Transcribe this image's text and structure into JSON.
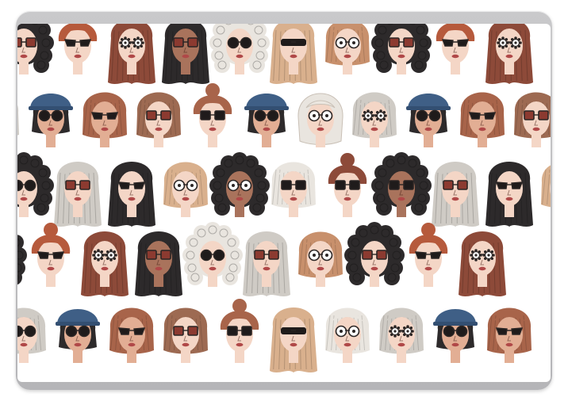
{
  "palette": {
    "frame": "#c2c2c5",
    "background": "#ffffff",
    "skin_light": "#f4d6c6",
    "skin_mid": "#e2ae94",
    "skin_dark": "#a9735c",
    "lips": "#b04848",
    "ink": "#2a2524",
    "hat_blue": "#3f5f86",
    "lens_red": "#8c3a30"
  },
  "hair_colors": {
    "ginger": "#b65a3c",
    "auburn": "#8d4a39",
    "brown": "#9d6a52",
    "black": "#2d2a2b",
    "grey": "#cfcbc5",
    "white": "#e9e5df",
    "blonde": "#d9b08d",
    "sandy": "#c8906c",
    "chestnut": "#a8644a"
  },
  "rows": [
    [
      {
        "hair": "black",
        "style": "curly",
        "skin": "skin_light",
        "glasses": "square_red"
      },
      {
        "hair": "ginger",
        "style": "bun",
        "skin": "skin_light",
        "glasses": "cat"
      },
      {
        "hair": "auburn",
        "style": "long",
        "skin": "skin_light",
        "glasses": "flower"
      },
      {
        "hair": "black",
        "style": "long",
        "skin": "skin_dark",
        "glasses": "square_red"
      },
      {
        "hair": "white",
        "style": "curly",
        "skin": "skin_light",
        "glasses": "round"
      },
      {
        "hair": "blonde",
        "style": "long",
        "skin": "skin_light",
        "glasses": "visor"
      },
      {
        "hair": "sandy",
        "style": "bob",
        "skin": "skin_light",
        "glasses": "round_white"
      },
      {
        "hair": "black",
        "style": "curly",
        "skin": "skin_light",
        "glasses": "square_red"
      },
      {
        "hair": "ginger",
        "style": "bun",
        "skin": "skin_light",
        "glasses": "cat"
      },
      {
        "hair": "auburn",
        "style": "long",
        "skin": "skin_light",
        "glasses": "flower"
      }
    ],
    [
      {
        "hair": "grey",
        "style": "bob",
        "skin": "skin_light",
        "glasses": "round"
      },
      {
        "hair": "black",
        "style": "hat",
        "skin": "skin_mid",
        "glasses": "round"
      },
      {
        "hair": "chestnut",
        "style": "bob",
        "skin": "skin_mid",
        "glasses": "cat"
      },
      {
        "hair": "brown",
        "style": "bob",
        "skin": "skin_light",
        "glasses": "square_red"
      },
      {
        "hair": "chestnut",
        "style": "bun",
        "skin": "skin_light",
        "glasses": "square"
      },
      {
        "hair": "black",
        "style": "hat",
        "skin": "skin_mid",
        "glasses": "round"
      },
      {
        "hair": "white",
        "style": "headscarf",
        "skin": "skin_light",
        "glasses": "round_white"
      },
      {
        "hair": "grey",
        "style": "bob",
        "skin": "skin_light",
        "glasses": "flower"
      },
      {
        "hair": "black",
        "style": "hat",
        "skin": "skin_mid",
        "glasses": "round"
      },
      {
        "hair": "chestnut",
        "style": "bob",
        "skin": "skin_mid",
        "glasses": "cat"
      },
      {
        "hair": "brown",
        "style": "bob",
        "skin": "skin_light",
        "glasses": "square_red"
      }
    ],
    [
      {
        "hair": "black",
        "style": "curly",
        "skin": "skin_light",
        "glasses": "round"
      },
      {
        "hair": "grey",
        "style": "long",
        "skin": "skin_light",
        "glasses": "square_red"
      },
      {
        "hair": "black",
        "style": "long",
        "skin": "skin_light",
        "glasses": "cat"
      },
      {
        "hair": "blonde",
        "style": "bob",
        "skin": "skin_light",
        "glasses": "round_white"
      },
      {
        "hair": "black",
        "style": "curly",
        "skin": "skin_dark",
        "glasses": "round_white"
      },
      {
        "hair": "white",
        "style": "bob",
        "skin": "skin_light",
        "glasses": "square"
      },
      {
        "hair": "auburn",
        "style": "bun",
        "skin": "skin_light",
        "glasses": "square"
      },
      {
        "hair": "black",
        "style": "curly",
        "skin": "skin_dark",
        "glasses": "square"
      },
      {
        "hair": "grey",
        "style": "long",
        "skin": "skin_light",
        "glasses": "square_red"
      },
      {
        "hair": "black",
        "style": "long",
        "skin": "skin_light",
        "glasses": "cat"
      },
      {
        "hair": "blonde",
        "style": "bob",
        "skin": "skin_light",
        "glasses": "round_white"
      }
    ],
    [
      {
        "hair": "black",
        "style": "curly",
        "skin": "skin_light",
        "glasses": "square_red"
      },
      {
        "hair": "ginger",
        "style": "bun",
        "skin": "skin_light",
        "glasses": "cat"
      },
      {
        "hair": "auburn",
        "style": "long",
        "skin": "skin_light",
        "glasses": "flower"
      },
      {
        "hair": "black",
        "style": "long",
        "skin": "skin_dark",
        "glasses": "square_red"
      },
      {
        "hair": "white",
        "style": "curly",
        "skin": "skin_light",
        "glasses": "round"
      },
      {
        "hair": "grey",
        "style": "long",
        "skin": "skin_light",
        "glasses": "square_red"
      },
      {
        "hair": "sandy",
        "style": "bob",
        "skin": "skin_light",
        "glasses": "round_white"
      },
      {
        "hair": "black",
        "style": "curly",
        "skin": "skin_light",
        "glasses": "square_red"
      },
      {
        "hair": "ginger",
        "style": "bun",
        "skin": "skin_light",
        "glasses": "cat"
      },
      {
        "hair": "auburn",
        "style": "long",
        "skin": "skin_light",
        "glasses": "flower"
      }
    ],
    [
      {
        "hair": "grey",
        "style": "bob",
        "skin": "skin_light",
        "glasses": "round"
      },
      {
        "hair": "black",
        "style": "hat",
        "skin": "skin_mid",
        "glasses": "round"
      },
      {
        "hair": "chestnut",
        "style": "bob",
        "skin": "skin_mid",
        "glasses": "cat"
      },
      {
        "hair": "brown",
        "style": "bob",
        "skin": "skin_light",
        "glasses": "square_red"
      },
      {
        "hair": "chestnut",
        "style": "bun",
        "skin": "skin_light",
        "glasses": "square"
      },
      {
        "hair": "blonde",
        "style": "long",
        "skin": "skin_light",
        "glasses": "visor"
      },
      {
        "hair": "white",
        "style": "bob",
        "skin": "skin_light",
        "glasses": "round_white"
      },
      {
        "hair": "grey",
        "style": "bob",
        "skin": "skin_light",
        "glasses": "flower"
      },
      {
        "hair": "black",
        "style": "hat",
        "skin": "skin_mid",
        "glasses": "round"
      },
      {
        "hair": "chestnut",
        "style": "bob",
        "skin": "skin_mid",
        "glasses": "cat"
      }
    ]
  ]
}
